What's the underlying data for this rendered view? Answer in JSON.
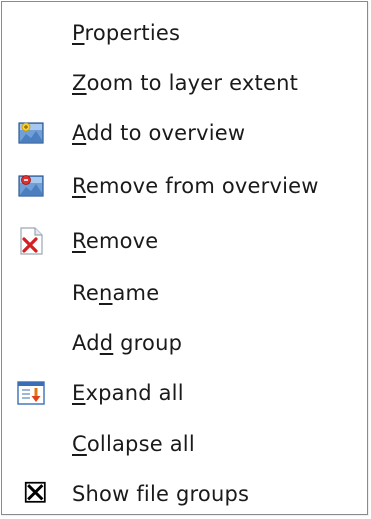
{
  "context_menu": {
    "items": [
      {
        "label": "Properties",
        "mnemonic_index": 0,
        "icon": null
      },
      {
        "label": "Zoom to layer extent",
        "mnemonic_index": 0,
        "icon": null
      },
      {
        "label": "Add to overview",
        "mnemonic_index": 0,
        "icon": "add-overview-icon"
      },
      {
        "label": "Remove from overview",
        "mnemonic_index": 0,
        "icon": "remove-overview-icon"
      },
      {
        "label": "Remove",
        "mnemonic_index": 0,
        "icon": "remove-document-icon"
      },
      {
        "label": "Rename",
        "mnemonic_index": 2,
        "icon": null
      },
      {
        "label": "Add group",
        "mnemonic_index": 2,
        "icon": null
      },
      {
        "label": "Expand all",
        "mnemonic_index": 0,
        "icon": "expand-all-icon"
      },
      {
        "label": "Collapse all",
        "mnemonic_index": 0,
        "icon": null
      },
      {
        "label": "Show file groups",
        "mnemonic_index": -1,
        "icon": "checkbox-checked-icon",
        "checked": true
      }
    ]
  },
  "colors": {
    "border": "#8a8a8a",
    "text": "#1a1a1a",
    "remove_red": "#d42020",
    "icon_blue": "#3a6fb8"
  }
}
